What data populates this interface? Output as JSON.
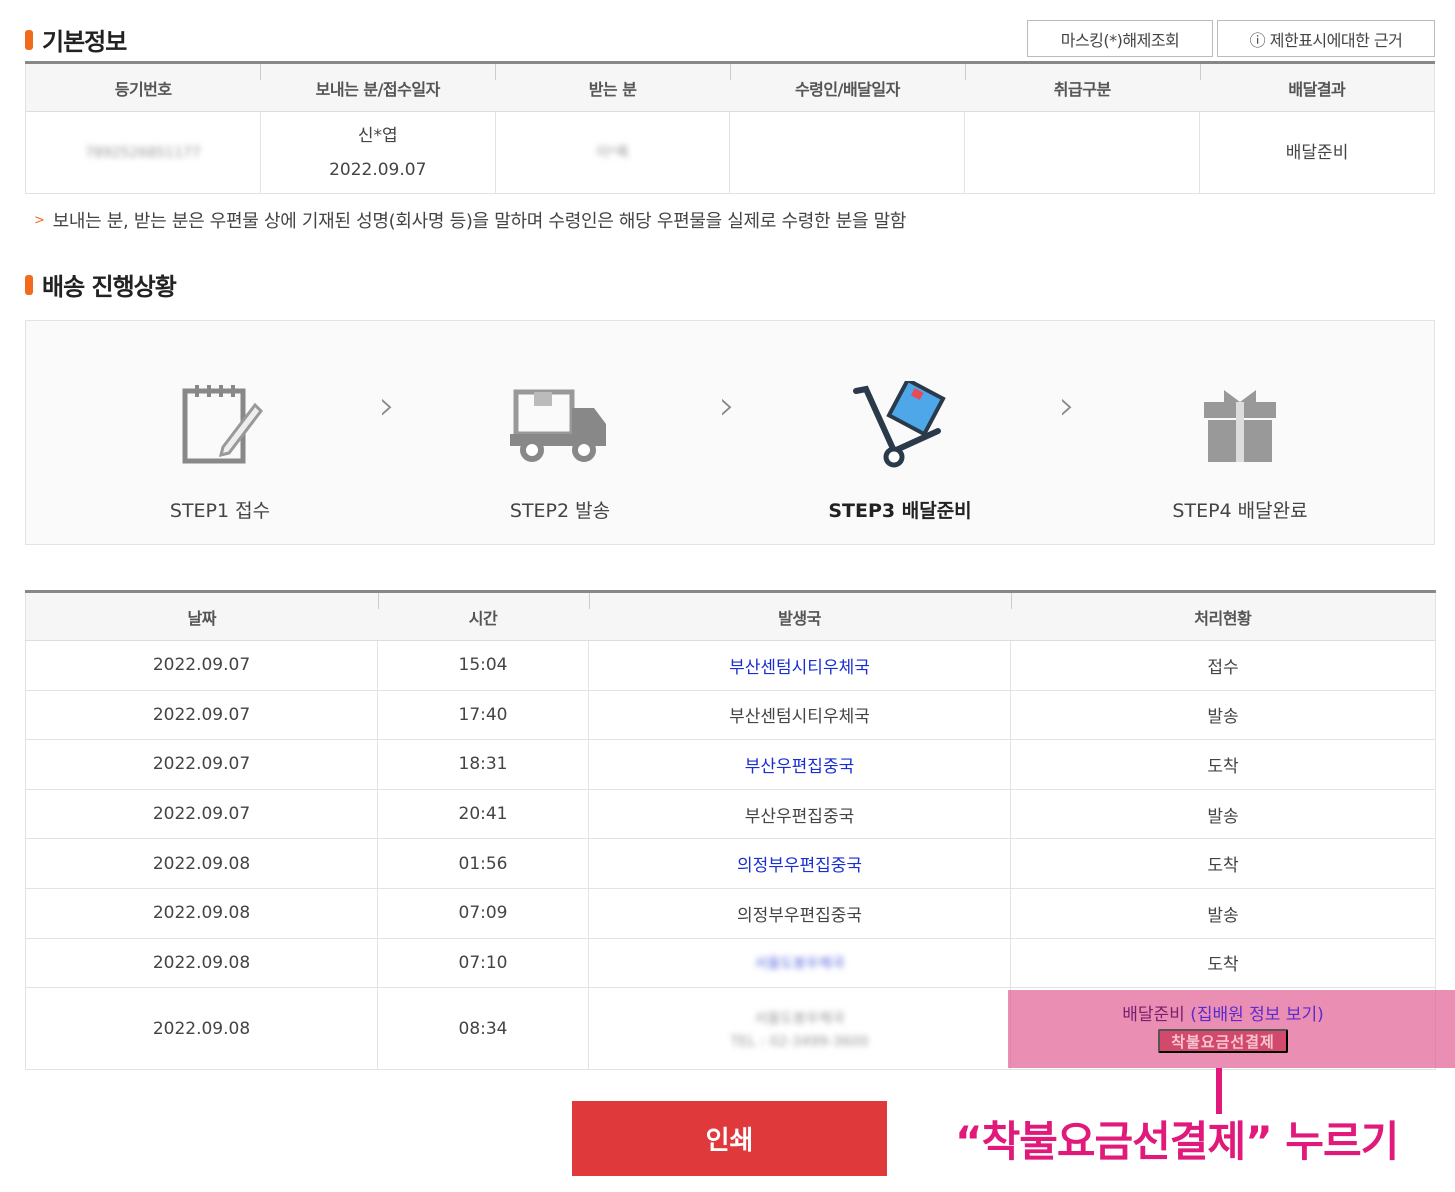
{
  "basic": {
    "title": "기본정보",
    "mask_button": "마스킹(*)해제조회",
    "limit_button": "ⓘ 제한표시에대한 근거",
    "headers": [
      "등기번호",
      "보내는 분/접수일자",
      "받는 분",
      "수령인/배달일자",
      "취급구분",
      "배달결과"
    ],
    "row": {
      "reg_no": "7892526851177",
      "sender": "신*엽",
      "date": "2022.09.07",
      "receiver": "이*록",
      "recipient": "",
      "handling": "",
      "result": "배달준비"
    },
    "note": "보내는 분, 받는 분은 우편물 상에 기재된 성명(회사명 등)을 말하며 수령인은 해당 우편물을 실제로 수령한 분을 말함"
  },
  "progress": {
    "title": "배송 진행상황",
    "steps": [
      {
        "label": "STEP1 접수",
        "icon": "notepad-icon"
      },
      {
        "label": "STEP2 발송",
        "icon": "truck-icon"
      },
      {
        "label": "STEP3 배달준비",
        "icon": "handcart-icon"
      },
      {
        "label": "STEP4 배달완료",
        "icon": "gift-icon"
      }
    ],
    "active_step": 3
  },
  "history": {
    "headers": [
      "날짜",
      "시간",
      "발생국",
      "처리현황"
    ],
    "rows": [
      {
        "date": "2022.09.07",
        "time": "15:04",
        "office": "부산센텀시티우체국",
        "status": "접수"
      },
      {
        "date": "2022.09.07",
        "time": "17:40",
        "office": "부산센텀시티우체국",
        "status": "발송"
      },
      {
        "date": "2022.09.07",
        "time": "18:31",
        "office": "부산우편집중국",
        "status": "도착"
      },
      {
        "date": "2022.09.07",
        "time": "20:41",
        "office": "부산우편집중국",
        "status": "발송"
      },
      {
        "date": "2022.09.08",
        "time": "01:56",
        "office": "의정부우편집중국",
        "status": "도착"
      },
      {
        "date": "2022.09.08",
        "time": "07:09",
        "office": "의정부우편집중국",
        "status": "발송"
      },
      {
        "date": "2022.09.08",
        "time": "07:10",
        "office": "서울도봉우체국",
        "status": "도착"
      },
      {
        "date": "2022.09.08",
        "time": "08:34",
        "office": "서울도봉우체국",
        "office_tel": "TEL : 02-3499-3600",
        "status": "배달준비",
        "status_link": "(집배원 정보 보기)",
        "pay_button": "착불요금선결제"
      }
    ]
  },
  "print_button": "인쇄",
  "guide_text": "“착불요금선결제” 누르기",
  "colors": {
    "accent": "#f26a1b",
    "link": "#1a2ed1",
    "print": "#e0393b",
    "guide": "#e0197a",
    "highlight": "#e25890"
  }
}
